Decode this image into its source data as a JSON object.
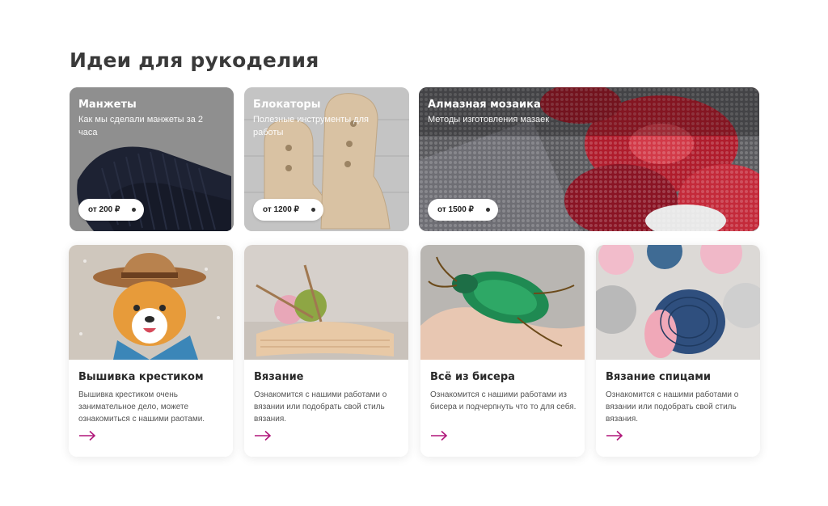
{
  "section": {
    "title": "Идеи для рукоделия"
  },
  "heroes": [
    {
      "title": "Манжеты",
      "subtitle": "Как мы сделали манжеты за 2 часа",
      "price": "от 200 ₽"
    },
    {
      "title": "Блокаторы",
      "subtitle": "Полезные инструменты для работы",
      "price": "от 1200 ₽"
    },
    {
      "title": "Алмазная мозаика",
      "subtitle": "Методы изготовления мазаек",
      "price": "от 1500 ₽"
    }
  ],
  "cards": [
    {
      "title": "Вышивка крестиком",
      "desc": "Вышивка крестиком очень занимательное дело, можете ознакомиться с нашими раотами."
    },
    {
      "title": "Вязание",
      "desc": "Ознакомится с нашими работами о вязании или подобрать свой стиль вязания."
    },
    {
      "title": "Всё из бисера",
      "desc": "Ознакомится с нашими работами из бисера и подчерпнуть что то для себя."
    },
    {
      "title": "Вязание спицами",
      "desc": "Ознакомится с нашими работами о вязании или подобрать свой стиль вязания."
    }
  ],
  "colors": {
    "accent": "#b0177a",
    "card_bg": "#ffffff",
    "text": "#2b2b2b"
  },
  "icons": {
    "card_link": "arrow-right-icon",
    "price_marker": "dot-icon"
  }
}
